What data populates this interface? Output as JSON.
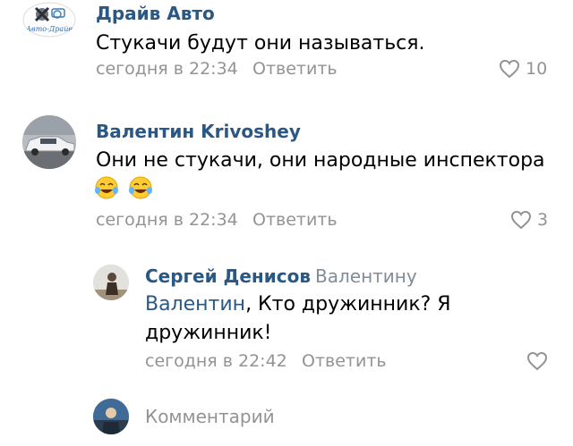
{
  "colors": {
    "name": "#2a5885",
    "meta": "#939393",
    "text": "#000000",
    "background": "#ffffff"
  },
  "comments": [
    {
      "author": "Драйв Авто",
      "avatar_icon": "auto-drive-logo-icon",
      "avatar_logo_text": "Авто-Драйв",
      "text": "Стукачи будут они называться.",
      "time": "сегодня в 22:34",
      "reply_label": "Ответить",
      "likes": "10"
    },
    {
      "author": "Валентин Krivoshey",
      "avatar_icon": "white-car-photo",
      "text": "Они не стукачи, они народные инспектора",
      "emojis": [
        "tears-of-joy-emoji",
        "tears-of-joy-emoji"
      ],
      "time": "сегодня в 22:34",
      "reply_label": "Ответить",
      "likes": "3"
    },
    {
      "author": "Сергей Денисов",
      "reply_to": "Валентину",
      "avatar_icon": "user-photo",
      "mention": "Валентин",
      "text_after_mention": ", Кто дружинник? Я",
      "text_line2": "дружинник!",
      "time": "сегодня в 22:42",
      "reply_label": "Ответить",
      "likes": ""
    }
  ],
  "composer": {
    "avatar_icon": "current-user-photo",
    "placeholder": "Комментарий"
  }
}
